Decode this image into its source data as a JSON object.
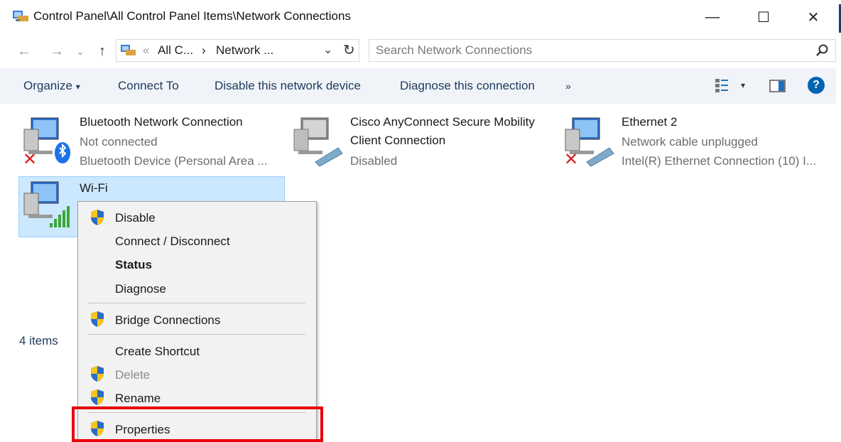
{
  "window": {
    "title": "Control Panel\\All Control Panel Items\\Network Connections",
    "minimize_glyph": "—",
    "maximize_glyph": "☐",
    "close_glyph": "✕"
  },
  "address": {
    "back_glyph": "←",
    "forward_glyph": "→",
    "recent_glyph": "⌄",
    "up_glyph": "↑",
    "chevron_left": "«",
    "crumb1": "All C...",
    "separator": "›",
    "crumb2": "Network ...",
    "dropdown_glyph": "⌄",
    "refresh_glyph": "↻",
    "search_placeholder": "Search Network Connections",
    "search_icon": "search-icon"
  },
  "toolbar": {
    "organize": "Organize",
    "organize_arrow": "▾",
    "connect_to": "Connect To",
    "disable_device": "Disable this network device",
    "diagnose": "Diagnose this connection",
    "more": "»",
    "view_arrow": "▾",
    "help": "?"
  },
  "connections": [
    {
      "name": "Bluetooth Network Connection",
      "status": "Not connected",
      "device": "Bluetooth Device (Personal Area ..."
    },
    {
      "name_line1": "Cisco AnyConnect Secure Mobility",
      "name_line2": "Client Connection",
      "status": "Disabled"
    },
    {
      "name": "Ethernet 2",
      "status": "Network cable unplugged",
      "device": "Intel(R) Ethernet Connection (10) I..."
    },
    {
      "name": "Wi-Fi"
    }
  ],
  "status_bar": {
    "count": "4 items"
  },
  "context_menu": {
    "disable": "Disable",
    "connect": "Connect / Disconnect",
    "status": "Status",
    "diagnose": "Diagnose",
    "bridge": "Bridge Connections",
    "shortcut": "Create Shortcut",
    "delete": "Delete",
    "rename": "Rename",
    "properties": "Properties"
  },
  "colors": {
    "accent": "#0063b1",
    "highlight": "#e8000b",
    "selection": "#cce8ff"
  }
}
